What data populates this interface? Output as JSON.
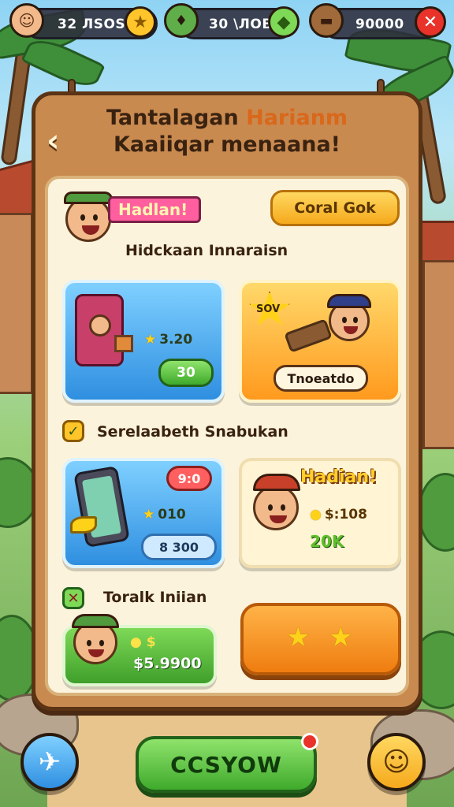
{
  "resources": [
    {
      "value": "32 ЛSOSiн",
      "icon": "star-icon"
    },
    {
      "value": "30 \\ЛOB",
      "icon": "gem-icon"
    },
    {
      "value": "90000",
      "icon": "close-icon"
    }
  ],
  "board": {
    "title_part1": "Tantalagan ",
    "title_highlight": "Harianm",
    "title_line2": "Kaaiiqar menaana!"
  },
  "header_card": {
    "ribbon": "Hadlan!",
    "button": "Coral Gok",
    "subtitle": "Hidckaan Innaraisn"
  },
  "card1": {
    "stat": "3.20",
    "button": "30"
  },
  "card2": {
    "badge": "SOV",
    "label": "Tnoeatdo"
  },
  "section2": {
    "title": "Serelaabeth Snabukan"
  },
  "card3": {
    "badge": "9:0",
    "stat": "010",
    "button": "8 300"
  },
  "card4": {
    "ribbon": "Hadian!",
    "stat": "$:108",
    "bonus": "20K"
  },
  "section3": {
    "title": "Toralk Iniian"
  },
  "card5": {
    "stat": "$5.9900"
  },
  "bottom": {
    "main_button": "CCSYOW"
  },
  "colors": {
    "accent_orange": "#ef7d10",
    "accent_green": "#3faa2c",
    "board_brown": "#c98a50"
  }
}
